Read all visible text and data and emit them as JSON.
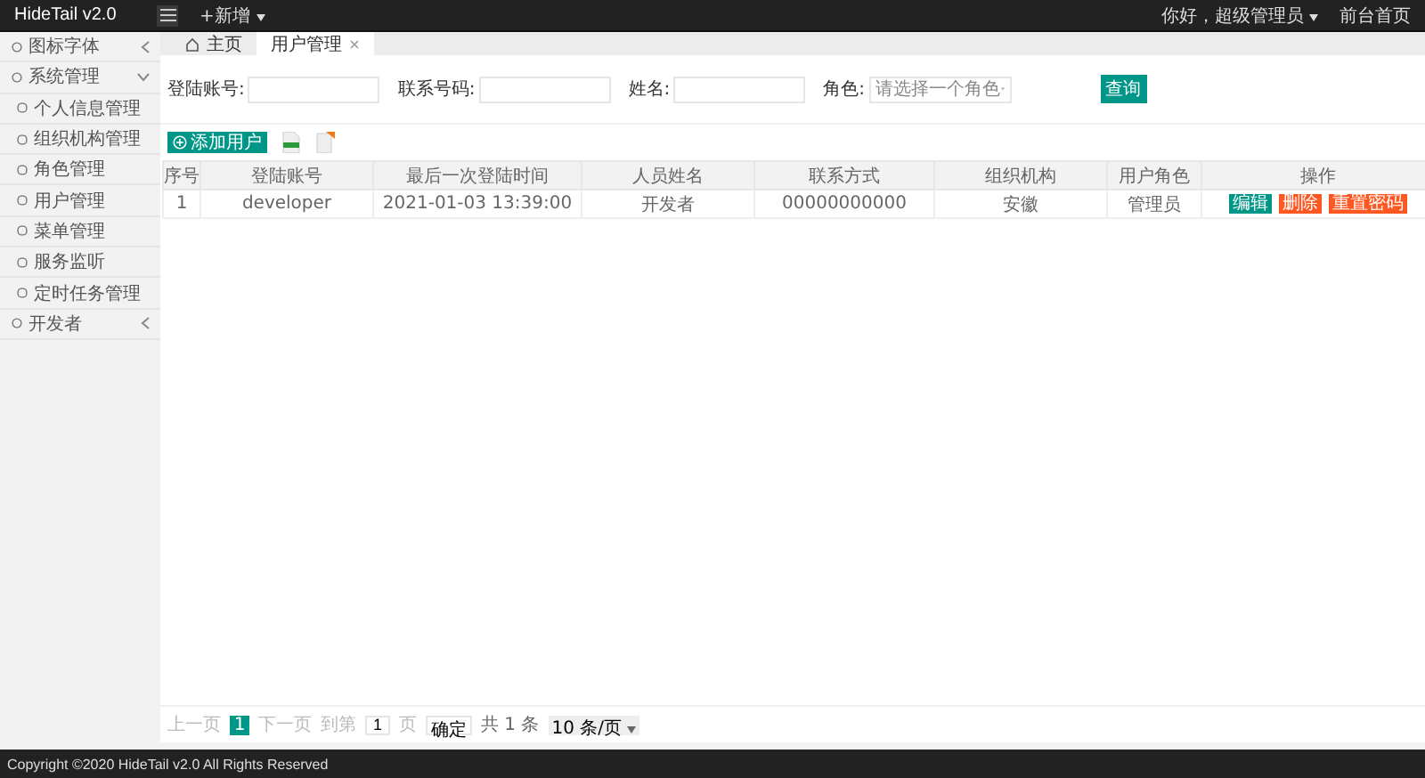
{
  "header": {
    "logo": "HideTail v2.0",
    "new_menu": "+新增",
    "user_menu": "你好，超级管理员",
    "home_link": "前台首页"
  },
  "sidebar": {
    "items": [
      {
        "label": "图标字体",
        "expanded": false
      },
      {
        "label": "系统管理",
        "expanded": true,
        "children": [
          {
            "label": "个人信息管理"
          },
          {
            "label": "组织机构管理"
          },
          {
            "label": "角色管理"
          },
          {
            "label": "用户管理"
          },
          {
            "label": "菜单管理"
          },
          {
            "label": "服务监听"
          },
          {
            "label": "定时任务管理"
          }
        ]
      },
      {
        "label": "开发者",
        "expanded": false
      }
    ]
  },
  "tabs": [
    {
      "label": "主页",
      "selected": false,
      "closable": false
    },
    {
      "label": "用户管理",
      "selected": true,
      "closable": true
    }
  ],
  "filters": [
    {
      "label": "登陆账号:",
      "kind": "input"
    },
    {
      "label": "联系号码:",
      "kind": "input"
    },
    {
      "label": "姓名:",
      "kind": "input"
    },
    {
      "label": "角色:",
      "kind": "select",
      "placeholder": "请选择一个角色"
    }
  ],
  "search_button": "查询",
  "add_button": "添加用户",
  "table": {
    "columns": [
      "序号",
      "登陆账号",
      "最后一次登陆时间",
      "人员姓名",
      "联系方式",
      "组织机构",
      "用户角色",
      "操作"
    ],
    "rows": [
      {
        "cells": [
          "1",
          "developer",
          "2021-01-03 13:39:00",
          "开发者",
          "00000000000",
          "安徽",
          "管理员"
        ],
        "actions": [
          {
            "label": "编辑",
            "kind": "primary"
          },
          {
            "label": "删除",
            "kind": "danger"
          },
          {
            "label": "重置密码",
            "kind": "danger"
          }
        ]
      }
    ]
  },
  "pagination": {
    "prev": "上一页",
    "pages": [
      {
        "label": "1",
        "selected": true
      }
    ],
    "next": "下一页",
    "goto": "到第",
    "page_input": "1",
    "page_unit": "页",
    "confirm": "确定",
    "total": "共 1 条",
    "page_size": "10 条/页"
  },
  "footer": "Copyright ©2020 HideTail v2.0 All Rights Reserved"
}
